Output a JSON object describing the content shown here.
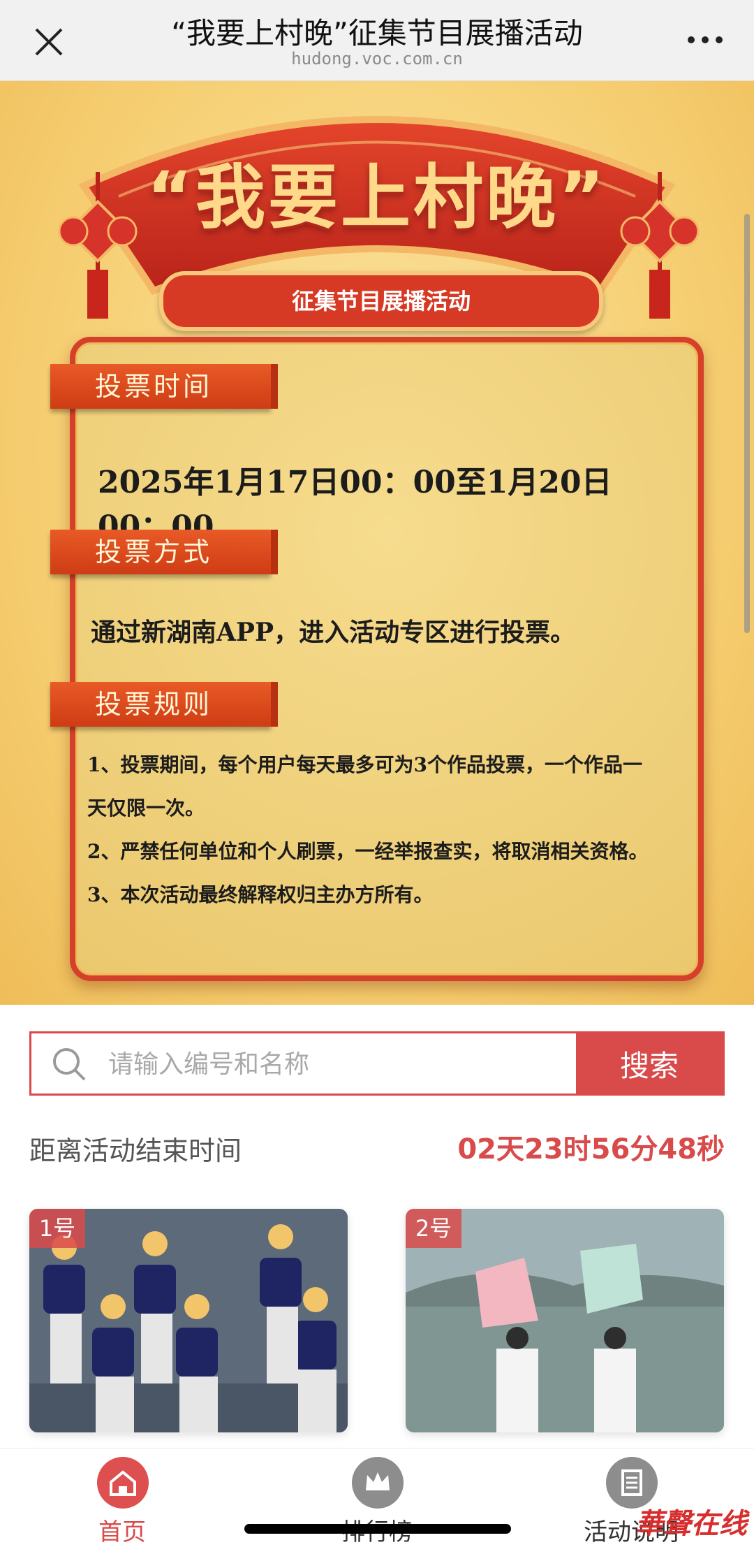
{
  "header": {
    "title": "“我要上村晚”征集节目展播活动",
    "url": "hudong.voc.com.cn"
  },
  "banner": {
    "main_title": "“我要上村晚”",
    "sub_title": "征集节目展播活动",
    "sections": {
      "time_label": "投票时间",
      "time_value": "2025年1月17日00：00至1月20日00：00",
      "method_label": "投票方式",
      "method_value": "通过新湖南APP，进入活动专区进行投票。",
      "rules_label": "投票规则",
      "rules": [
        "1、投票期间，每个用户每天最多可为3个作品投票，一个作品一",
        "天仅限一次。",
        "2、严禁任何单位和个人刷票，一经举报查实，将取消相关资格。",
        "3、本次活动最终解释权归主办方所有。"
      ]
    }
  },
  "search": {
    "placeholder": "请输入编号和名称",
    "button_label": "搜索"
  },
  "countdown": {
    "label": "距离活动结束时间",
    "value": "02天23时56分48秒"
  },
  "works": [
    {
      "number": "1号"
    },
    {
      "number": "2号"
    }
  ],
  "tabbar": {
    "items": [
      {
        "label": "首页",
        "icon": "home-icon",
        "active": true
      },
      {
        "label": "排行榜",
        "icon": "crown-icon",
        "active": false
      },
      {
        "label": "活动说明",
        "icon": "document-icon",
        "active": false
      }
    ]
  },
  "watermark": "華聲在线",
  "colors": {
    "accent": "#d94a4a",
    "banner_bg": "#f6cf73",
    "tag": "#d84a1f"
  }
}
